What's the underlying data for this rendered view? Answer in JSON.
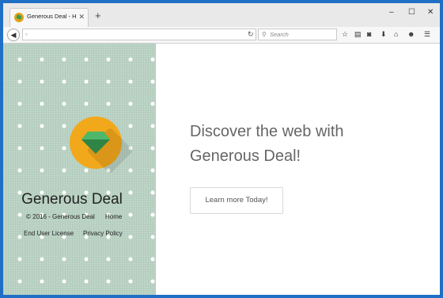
{
  "browser": {
    "tab_title": "Generous Deal - Home Pa...",
    "tab_close": "✕",
    "new_tab": "+",
    "window_controls": {
      "minimize": "–",
      "maximize": "☐",
      "close": "✕"
    },
    "search_placeholder": "Search",
    "icons": [
      "back-arrow",
      "page-icon",
      "reload",
      "search",
      "bookmark-star",
      "reading-list",
      "pocket",
      "download",
      "home",
      "smiley",
      "menu"
    ]
  },
  "page": {
    "brand": "Generous Deal",
    "copyright": "© 2016 - Generous Deal",
    "home_link": "Home",
    "eula_link": "End User License",
    "privacy_link": "Privacy Policy",
    "headline_line1": "Discover the web with",
    "headline_line2": "Generous Deal!",
    "cta_label": "Learn more Today!"
  },
  "colors": {
    "window_frame": "#1f6fc4",
    "left_panel_bg": "#b9d2c3",
    "logo_orange": "#f2a81b",
    "logo_gem_green": "#3a9a53",
    "headline_text": "#666666"
  }
}
